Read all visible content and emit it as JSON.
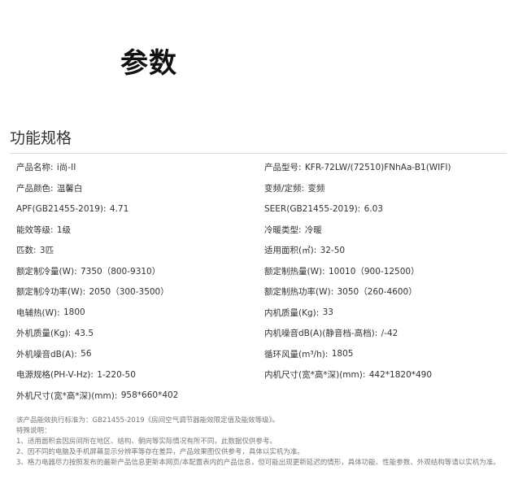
{
  "page": {
    "title": "参数",
    "section_title": "功能规格"
  },
  "specs": [
    {
      "label": "产品名称:",
      "value": "i尚-II"
    },
    {
      "label": "产品型号:",
      "value": "KFR-72LW/(72510)FNhAa-B1(WIFI)"
    },
    {
      "label": "产品颜色:",
      "value": "温馨白"
    },
    {
      "label": "变频/定频:",
      "value": "变频"
    },
    {
      "label": "APF(GB21455-2019):",
      "value": "4.71"
    },
    {
      "label": "SEER(GB21455-2019):",
      "value": "6.03"
    },
    {
      "label": "能效等级:",
      "value": "1级"
    },
    {
      "label": "冷暖类型:",
      "value": "冷暖"
    },
    {
      "label": "匹数:",
      "value": "3匹"
    },
    {
      "label": "适用面积(㎡):",
      "value": "32-50"
    },
    {
      "label": "额定制冷量(W):",
      "value": "7350（800-9310）"
    },
    {
      "label": "额定制热量(W):",
      "value": "10010（900-12500）"
    },
    {
      "label": "额定制冷功率(W):",
      "value": "2050（300-3500）"
    },
    {
      "label": "额定制热功率(W):",
      "value": "3050（260-4600）"
    },
    {
      "label": "电辅热(W):",
      "value": "1800"
    },
    {
      "label": "内机质量(Kg):",
      "value": "33"
    },
    {
      "label": "外机质量(Kg):",
      "value": "43.5"
    },
    {
      "label": "内机噪音dB(A)(静音档-高档):",
      "value": "/-42"
    },
    {
      "label": "外机噪音dB(A):",
      "value": "56"
    },
    {
      "label": "循环风量(m³/h):",
      "value": "1805"
    },
    {
      "label": "电源规格(PH-V-Hz):",
      "value": "1-220-50"
    },
    {
      "label": "内机尺寸(宽*高*深)(mm):",
      "value": "442*1820*490"
    },
    {
      "label": "外机尺寸(宽*高*深)(mm):",
      "value": "958*660*402"
    }
  ],
  "notes": {
    "line1": "该产品能效执行标准为：GB21455-2019《房间空气调节器能效限定值及能效等级》。",
    "line2": "特殊说明：",
    "line3": "1、适用面积会因房间所在地区、结构、朝向等实际情况有所不同，此数据仅供参考。",
    "line4": "2、因不同的电脑及手机屏幕显示分辨率等存在差异，产品效果图仅供参考，具体以实机为准。",
    "line5": "3、格力电器尽力按照发布的最新产品信息更新本网页/本配置表内的产品信息，但可能出现更新延迟的情形，具体功能、性能参数、外观结构等请以实机为准。"
  }
}
